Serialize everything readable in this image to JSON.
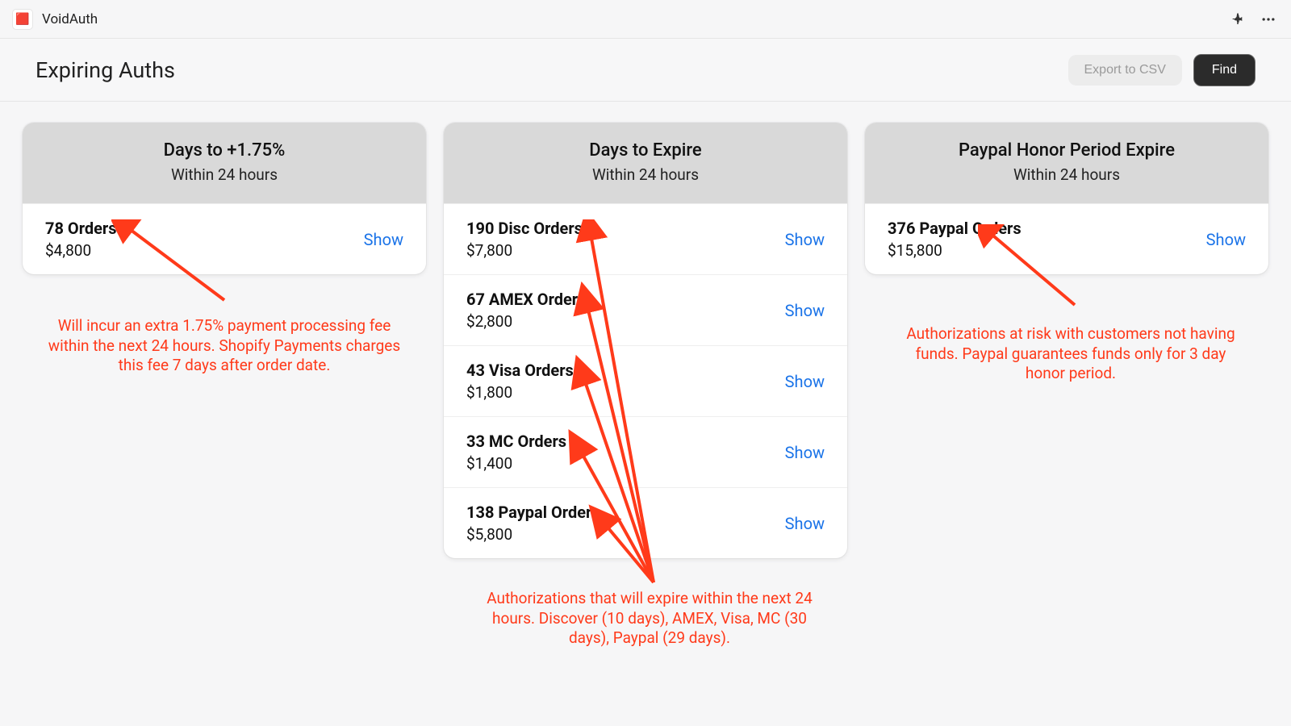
{
  "app": {
    "name": "VoidAuth",
    "icon_glyph": "🟥"
  },
  "page": {
    "title": "Expiring Auths"
  },
  "actions": {
    "export": "Export to CSV",
    "find": "Find"
  },
  "columns": [
    {
      "title": "Days to +1.75%",
      "subtitle": "Within 24 hours",
      "rows": [
        {
          "label": "78 Orders",
          "amount": "$4,800",
          "link": "Show"
        }
      ],
      "annotation": "Will incur an extra 1.75% payment processing fee within the next 24 hours.  Shopify Payments charges this fee 7 days after order date."
    },
    {
      "title": "Days to Expire",
      "subtitle": "Within 24 hours",
      "rows": [
        {
          "label": "190 Disc Orders",
          "amount": "$7,800",
          "link": "Show"
        },
        {
          "label": "67 AMEX Orders",
          "amount": "$2,800",
          "link": "Show"
        },
        {
          "label": "43 Visa Orders",
          "amount": "$1,800",
          "link": "Show"
        },
        {
          "label": "33 MC Orders",
          "amount": "$1,400",
          "link": "Show"
        },
        {
          "label": "138 Paypal Orders",
          "amount": "$5,800",
          "link": "Show"
        }
      ],
      "annotation": "Authorizations that will expire within the next 24 hours.  Discover (10 days), AMEX, Visa, MC (30 days), Paypal (29 days)."
    },
    {
      "title": "Paypal Honor Period Expire",
      "subtitle": "Within 24 hours",
      "rows": [
        {
          "label": "376 Paypal Orders",
          "amount": "$15,800",
          "link": "Show"
        }
      ],
      "annotation": "Authorizations at risk with customers not having funds.  Paypal guarantees funds only for 3 day honor period."
    }
  ]
}
